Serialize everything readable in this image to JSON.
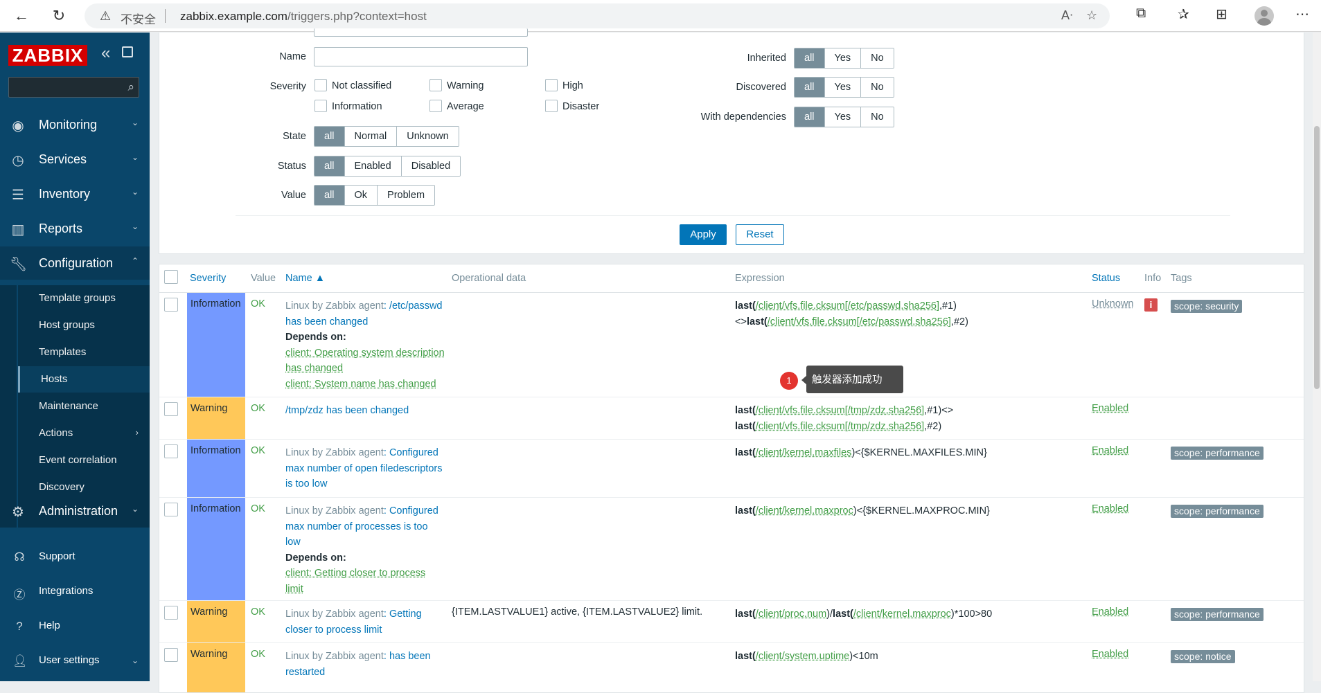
{
  "browser": {
    "insecure_label": "不安全",
    "url_host": "zabbix.example.com",
    "url_path": "/triggers.php?context=host"
  },
  "sidebar": {
    "logo": "ZABBIX",
    "menu": [
      {
        "label": "Monitoring",
        "icon": "eye-icon"
      },
      {
        "label": "Services",
        "icon": "clock-icon"
      },
      {
        "label": "Inventory",
        "icon": "list-icon"
      },
      {
        "label": "Reports",
        "icon": "bar-chart-icon"
      },
      {
        "label": "Configuration",
        "icon": "wrench-icon"
      }
    ],
    "config_submenu": [
      "Template groups",
      "Host groups",
      "Templates",
      "Hosts",
      "Maintenance",
      "Actions",
      "Event correlation",
      "Discovery"
    ],
    "administration": "Administration",
    "bottom": [
      "Support",
      "Integrations",
      "Help",
      "User settings"
    ]
  },
  "filter": {
    "name_label": "Name",
    "name_value": "",
    "severity_label": "Severity",
    "severities": [
      "Not classified",
      "Warning",
      "High",
      "Information",
      "Average",
      "Disaster"
    ],
    "state_label": "State",
    "state_options": [
      "all",
      "Normal",
      "Unknown"
    ],
    "status_label": "Status",
    "status_options": [
      "all",
      "Enabled",
      "Disabled"
    ],
    "value_label": "Value",
    "value_options": [
      "all",
      "Ok",
      "Problem"
    ],
    "inherited_label": "Inherited",
    "discovered_label": "Discovered",
    "dependencies_label": "With dependencies",
    "tri_options": [
      "all",
      "Yes",
      "No"
    ],
    "apply": "Apply",
    "reset": "Reset"
  },
  "table": {
    "headers": {
      "severity": "Severity",
      "value": "Value",
      "name": "Name ▲",
      "opdata": "Operational data",
      "expression": "Expression",
      "status": "Status",
      "info": "Info",
      "tags": "Tags"
    },
    "rows": [
      {
        "severity": "Information",
        "value": "OK",
        "template": "Linux by Zabbix agent",
        "name": "/etc/passwd has been changed",
        "depends_title": "Depends on:",
        "depends": [
          "client: Operating system description has changed",
          "client: System name has changed"
        ],
        "opdata": "",
        "expr": [
          "last(",
          "/client/vfs.file.cksum[/etc/passwd,sha256]",
          ",#1)<>",
          "last(",
          "/client/vfs.file.cksum[/etc/passwd,sha256]",
          ",#2)"
        ],
        "status": "Unknown",
        "info": "i",
        "tag": "scope: security"
      },
      {
        "severity": "Warning",
        "value": "OK",
        "name": "/tmp/zdz has been changed",
        "opdata": "",
        "expr": [
          "last(",
          "/client/vfs.file.cksum[/tmp/zdz,sha256]",
          ",#1)<> ",
          "last(",
          "/client/vfs.file.cksum[/tmp/zdz,sha256]",
          ",#2)"
        ],
        "status": "Enabled",
        "tag": ""
      },
      {
        "severity": "Information",
        "value": "OK",
        "template": "Linux by Zabbix agent",
        "name": "Configured max number of open filedescriptors is too low",
        "opdata": "",
        "expr": [
          "last(",
          "/client/kernel.maxfiles",
          ")<{$KERNEL.MAXFILES.MIN}"
        ],
        "status": "Enabled",
        "tag": "scope: performance"
      },
      {
        "severity": "Information",
        "value": "OK",
        "template": "Linux by Zabbix agent",
        "name": "Configured max number of processes is too low",
        "depends_title": "Depends on:",
        "depends": [
          "client: Getting closer to process limit"
        ],
        "opdata": "",
        "expr": [
          "last(",
          "/client/kernel.maxproc",
          ")<{$KERNEL.MAXPROC.MIN}"
        ],
        "status": "Enabled",
        "tag": "scope: performance"
      },
      {
        "severity": "Warning",
        "value": "OK",
        "template": "Linux by Zabbix agent",
        "name": "Getting closer to process limit",
        "opdata": "{ITEM.LASTVALUE1} active, {ITEM.LASTVALUE2} limit.",
        "expr": [
          "last(",
          "/client/proc.num",
          ")/",
          "last(",
          "/client/kernel.maxproc",
          ")*100>80"
        ],
        "status": "Enabled",
        "tag": "scope: performance"
      },
      {
        "severity": "Warning",
        "value": "OK",
        "template": "Linux by Zabbix agent",
        "name": "has been restarted",
        "opdata": "",
        "expr": [
          "last(",
          "/client/system.uptime",
          ")<10m"
        ],
        "status": "Enabled",
        "tag": "scope: notice"
      }
    ]
  },
  "tooltip": {
    "badge": "1",
    "text": "触发器添加成功"
  },
  "colors": {
    "sidebar": "#0a466a",
    "accent": "#0275b8",
    "info": "#7499ff",
    "warning": "#ffc859",
    "ok": "#429e47"
  }
}
